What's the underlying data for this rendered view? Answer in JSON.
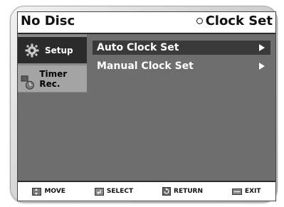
{
  "header": {
    "disc_status": "No Disc",
    "page_title": "Clock Set"
  },
  "sidebar": {
    "items": [
      {
        "label": "Setup",
        "icon": "gear-icon",
        "active": true
      },
      {
        "label": "Timer Rec.",
        "icon": "timer-icon",
        "active": false
      }
    ]
  },
  "menu": {
    "items": [
      {
        "label": "Auto Clock Set",
        "selected": true
      },
      {
        "label": "Manual Clock Set",
        "selected": false
      }
    ]
  },
  "footer": {
    "move": "MOVE",
    "select": "SELECT",
    "return": "RETURN",
    "exit": "EXIT"
  }
}
